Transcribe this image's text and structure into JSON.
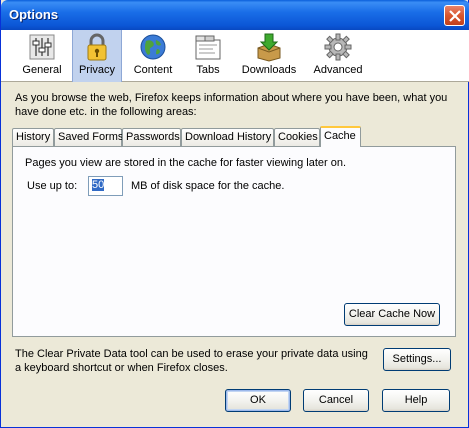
{
  "window": {
    "title": "Options"
  },
  "toolbar": {
    "items": [
      {
        "label": "General",
        "icon": "sliders-icon"
      },
      {
        "label": "Privacy",
        "icon": "padlock-icon",
        "selected": true
      },
      {
        "label": "Content",
        "icon": "globe-icon"
      },
      {
        "label": "Tabs",
        "icon": "tabs-icon"
      },
      {
        "label": "Downloads",
        "icon": "download-box-icon"
      },
      {
        "label": "Advanced",
        "icon": "gear-icon"
      }
    ]
  },
  "privacy": {
    "description": "As you browse the web, Firefox keeps information about where you have been, what you have done etc. in the following areas:",
    "tabs": [
      {
        "label": "History"
      },
      {
        "label": "Saved Forms"
      },
      {
        "label": "Passwords"
      },
      {
        "label": "Download History"
      },
      {
        "label": "Cookies"
      },
      {
        "label": "Cache",
        "active": true
      }
    ]
  },
  "cache": {
    "info": "Pages you view are stored in the cache for faster viewing later on.",
    "use_up_to_label": "Use up to:",
    "size_value": "50",
    "size_unit_label": "MB of disk space for the cache.",
    "clear_button": "Clear Cache Now"
  },
  "clear_private": {
    "text": "The Clear Private Data tool can be used to erase your private data using a keyboard shortcut or when Firefox closes.",
    "settings_button": "Settings..."
  },
  "dialog_buttons": {
    "ok": "OK",
    "cancel": "Cancel",
    "help": "Help"
  },
  "colors": {
    "titlebar": "#0a5fdb",
    "selected_tab_highlight": "#ffc83c",
    "selection": "#316ac5"
  }
}
